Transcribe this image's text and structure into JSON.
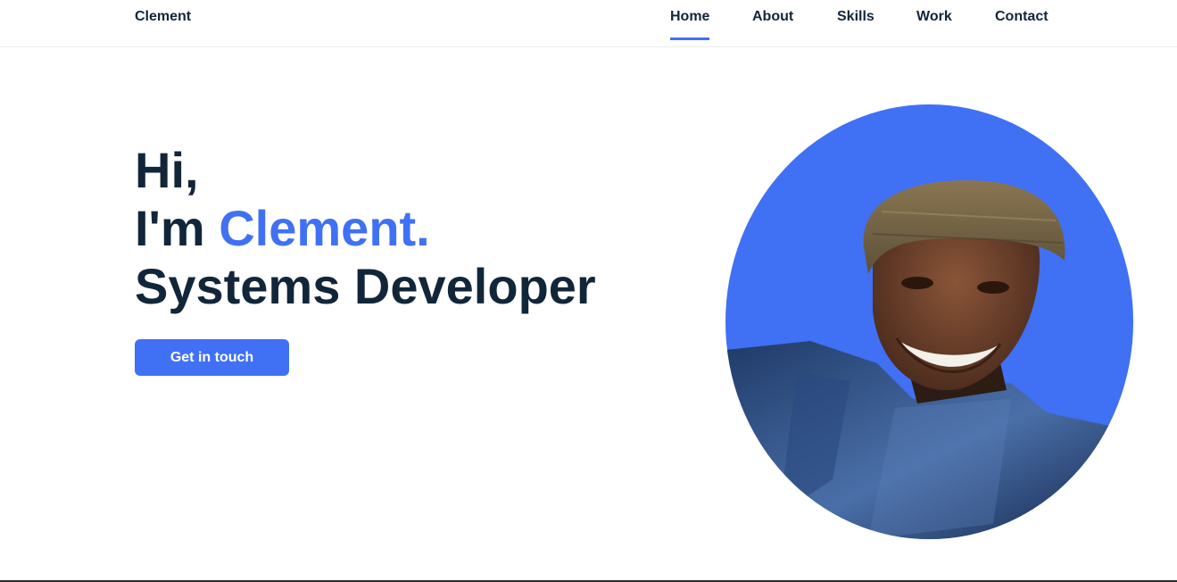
{
  "header": {
    "logo": "Clement",
    "nav": [
      {
        "label": "Home",
        "active": true
      },
      {
        "label": "About",
        "active": false
      },
      {
        "label": "Skills",
        "active": false
      },
      {
        "label": "Work",
        "active": false
      },
      {
        "label": "Contact",
        "active": false
      }
    ]
  },
  "hero": {
    "line1": "Hi,",
    "line2_prefix": "I'm ",
    "line2_name": "Clement.",
    "line3": "Systems Developer",
    "cta_label": "Get in touch"
  },
  "colors": {
    "accent": "#4070f4",
    "text": "#12263a",
    "background": "#ffffff"
  },
  "portrait": {
    "icon": "profile-photo"
  }
}
